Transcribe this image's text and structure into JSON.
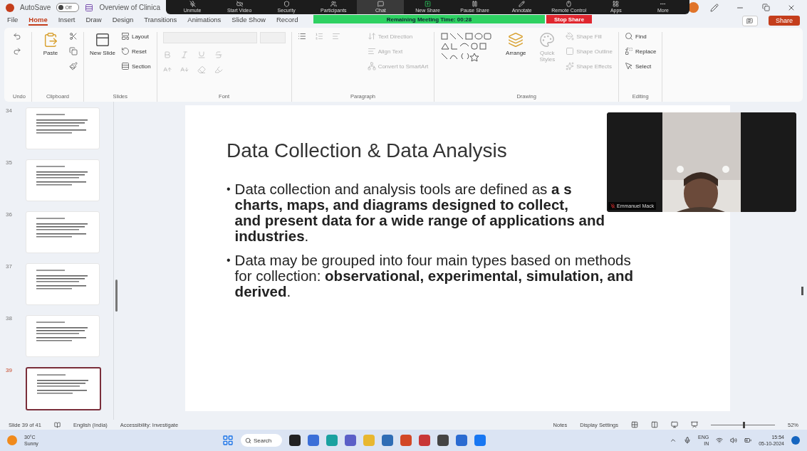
{
  "title_bar": {
    "autosave_label": "AutoSave",
    "autosave_on": false,
    "autosave_state": "Off",
    "document_title": "Overview of Clinica"
  },
  "meeting_toolbar": {
    "buttons": [
      {
        "label": "Unmute",
        "active": false
      },
      {
        "label": "Start Video",
        "active": false
      },
      {
        "label": "Security",
        "active": false
      },
      {
        "label": "Participants",
        "active": false
      },
      {
        "label": "Chat",
        "active": true
      },
      {
        "label": "New Share",
        "active": false
      },
      {
        "label": "Pause Share",
        "active": false
      },
      {
        "label": "Annotate",
        "active": false
      },
      {
        "label": "Remote Control",
        "active": false
      },
      {
        "label": "Apps",
        "active": false
      },
      {
        "label": "More",
        "active": false
      }
    ],
    "timer": "Remaining Meeting Time: 00:28",
    "stop_share": "Stop Share"
  },
  "ribbon": {
    "tabs": [
      {
        "label": "File",
        "selected": false
      },
      {
        "label": "Home",
        "selected": true
      },
      {
        "label": "Insert",
        "selected": false
      },
      {
        "label": "Draw",
        "selected": false
      },
      {
        "label": "Design",
        "selected": false
      },
      {
        "label": "Transitions",
        "selected": false
      },
      {
        "label": "Animations",
        "selected": false
      },
      {
        "label": "Slide Show",
        "selected": false
      },
      {
        "label": "Record",
        "selected": false
      }
    ],
    "share": "Share",
    "groups": [
      {
        "name": "Undo",
        "small": [
          {
            "kind": "undo",
            "disabled": false
          },
          {
            "kind": "redo",
            "disabled": false
          }
        ]
      },
      {
        "name": "Clipboard",
        "large": [
          {
            "label": "Paste",
            "kind": "paste",
            "disabled": false
          }
        ],
        "small": [
          {
            "kind": "cut",
            "disabled": false
          },
          {
            "kind": "copy",
            "disabled": false
          },
          {
            "kind": "brush",
            "disabled": false
          }
        ]
      },
      {
        "name": "Slides",
        "large": [
          {
            "label": "New Slide",
            "kind": "slide",
            "disabled": false
          }
        ],
        "small": [
          {
            "label": "Layout",
            "kind": "layout",
            "disabled": false
          },
          {
            "label": "Reset",
            "kind": "reset",
            "disabled": false
          },
          {
            "label": "Section",
            "kind": "section",
            "disabled": false
          }
        ]
      },
      {
        "name": "Font",
        "small": [
          {
            "kind": "bold",
            "disabled": true
          },
          {
            "kind": "italic",
            "disabled": true
          },
          {
            "kind": "underline",
            "disabled": true
          },
          {
            "kind": "strike",
            "disabled": true
          },
          {
            "kind": "grow",
            "disabled": true
          },
          {
            "kind": "shrink",
            "disabled": true
          },
          {
            "kind": "clear",
            "disabled": true
          },
          {
            "kind": "highlight",
            "disabled": true
          }
        ]
      },
      {
        "name": "Paragraph",
        "small": [
          {
            "kind": "list",
            "disabled": false
          },
          {
            "kind": "numbered",
            "disabled": true
          },
          {
            "kind": "align",
            "disabled": true
          },
          {
            "label": "Text Direction",
            "kind": "direction",
            "disabled": true
          },
          {
            "label": "Align Text",
            "kind": "align",
            "disabled": true
          },
          {
            "label": "Convert to SmartArt",
            "kind": "smartart",
            "disabled": true
          }
        ]
      },
      {
        "name": "Drawing",
        "large": [
          {
            "label": "Arrange",
            "kind": "arrange",
            "disabled": false
          },
          {
            "label": "Quick Styles",
            "kind": "styles",
            "disabled": true
          }
        ],
        "small": [
          {
            "label": "Shape Fill",
            "kind": "fill",
            "disabled": true
          },
          {
            "label": "Shape Outline",
            "kind": "outline",
            "disabled": true
          },
          {
            "label": "Shape Effects",
            "kind": "effects",
            "disabled": true
          }
        ]
      },
      {
        "name": "Editing",
        "small": [
          {
            "label": "Find",
            "kind": "find",
            "disabled": false
          },
          {
            "label": "Replace",
            "kind": "replace",
            "disabled": false
          },
          {
            "label": "Select",
            "kind": "select",
            "disabled": false
          }
        ]
      }
    ]
  },
  "thumbnails": [
    {
      "number": "34",
      "selected": false
    },
    {
      "number": "35",
      "selected": false
    },
    {
      "number": "36",
      "selected": false
    },
    {
      "number": "37",
      "selected": false
    },
    {
      "number": "38",
      "selected": false
    },
    {
      "number": "39",
      "selected": true
    }
  ],
  "slide": {
    "title": "Data Collection & Data Analysis",
    "bullets": [
      {
        "marker": "•",
        "lines": [
          {
            "text": "Data collection and analysis tools are defined as **a s**",
            "bold": false
          },
          {
            "text": "charts, maps, and diagrams designed to collect,",
            "bold": true
          },
          {
            "text": "and present data for a wide range of applications and",
            "bold": true
          },
          {
            "text": "**industries**.",
            "bold": false
          }
        ]
      },
      {
        "marker": "•",
        "lines": [
          {
            "text": "Data may be grouped into four main types based on methods",
            "bold": false
          },
          {
            "text": "for collection: **observational, experimental, simulation, and**",
            "bold": false
          },
          {
            "text": "**derived**.",
            "bold": false
          }
        ]
      }
    ]
  },
  "video": {
    "name": "Emmanuel Mack",
    "muted": true
  },
  "status_bar": {
    "slide_count": "Slide 39 of 41",
    "language": "English (India)",
    "accessibility": "Accessibility: Investigate",
    "notes": "Notes",
    "display_settings": "Display Settings",
    "zoom": {
      "level": 0.5,
      "reading": "52%"
    }
  },
  "taskbar": {
    "temperature": "30°C",
    "weather": "Sunny",
    "search": "Search",
    "language": "ENG",
    "region": "IN",
    "time": "15:54",
    "date": "05-10-2024"
  }
}
